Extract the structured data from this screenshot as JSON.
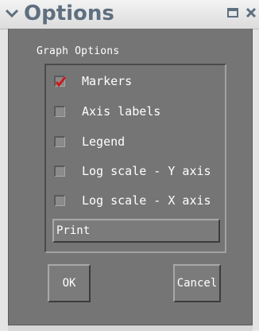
{
  "window": {
    "title": "Options",
    "menu_icon": "chevron-down-icon",
    "restore_icon": "restore-icon",
    "close_icon": "close-icon"
  },
  "group": {
    "label": "Graph Options"
  },
  "options": [
    {
      "label": "Markers",
      "checked": true
    },
    {
      "label": "Axis labels",
      "checked": false
    },
    {
      "label": "Legend",
      "checked": false
    },
    {
      "label": "Log scale - Y axis",
      "checked": false
    },
    {
      "label": "Log scale - X axis",
      "checked": false
    }
  ],
  "buttons": {
    "print": "Print",
    "ok": "OK",
    "cancel": "Cancel"
  },
  "colors": {
    "client_bg": "#757575",
    "title_text": "#5e6f80",
    "check_mark": "#d01818"
  }
}
